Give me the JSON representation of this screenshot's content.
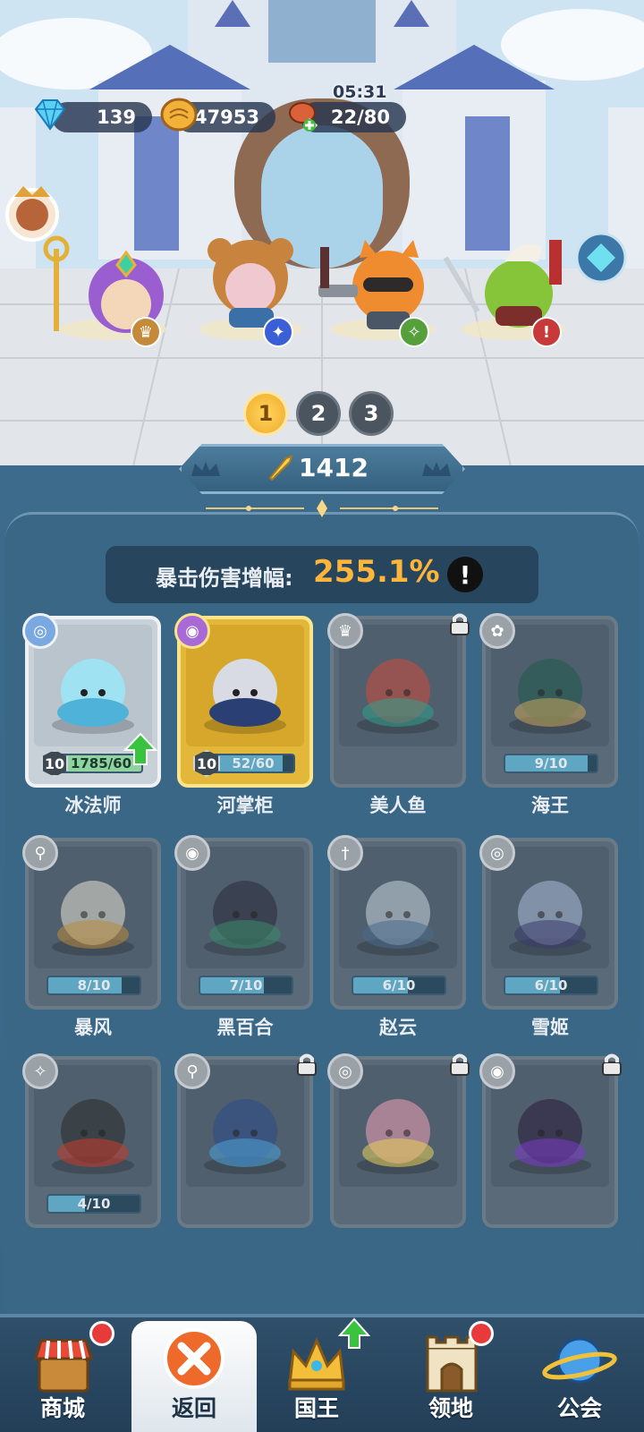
{
  "resources": {
    "gems": "139",
    "coins": "47953",
    "stamina_timer": "05:31",
    "stamina": "22/80"
  },
  "team_pages": [
    "1",
    "2",
    "3"
  ],
  "team_page_selected": "1",
  "power": "1412",
  "crit_bonus": {
    "label": "暴击伤害增幅:",
    "value": "255.1%",
    "info_glyph": "!"
  },
  "heroes": [
    {
      "name": "冰法师",
      "level": "10",
      "progress": "1785/60",
      "state": "owned",
      "class_icon": "swirl-icon",
      "upgrade": true
    },
    {
      "name": "河掌柜",
      "level": "10",
      "progress": "52/60",
      "fill": 0.87,
      "state": "gold",
      "class_icon": "eye-icon",
      "upgrade": false
    },
    {
      "name": "美人鱼",
      "level": "",
      "progress": "",
      "state": "locked",
      "class_icon": "crown-icon"
    },
    {
      "name": "海王",
      "level": "",
      "progress": "9/10",
      "fill": 0.9,
      "state": "shard",
      "class_icon": "paw-icon"
    },
    {
      "name": "暴风",
      "level": "",
      "progress": "8/10",
      "fill": 0.8,
      "state": "shard",
      "class_icon": "magnifier-icon"
    },
    {
      "name": "黑百合",
      "level": "",
      "progress": "7/10",
      "fill": 0.7,
      "state": "shard",
      "class_icon": "eye-icon"
    },
    {
      "name": "赵云",
      "level": "",
      "progress": "6/10",
      "fill": 0.6,
      "state": "shard",
      "class_icon": "sword-icon"
    },
    {
      "name": "雪姬",
      "level": "",
      "progress": "6/10",
      "fill": 0.6,
      "state": "shard",
      "class_icon": "swirl-icon"
    },
    {
      "name": "",
      "level": "",
      "progress": "4/10",
      "fill": 0.4,
      "state": "shard",
      "class_icon": "network-icon"
    },
    {
      "name": "",
      "level": "",
      "progress": "",
      "state": "locked",
      "class_icon": "magnifier-icon"
    },
    {
      "name": "",
      "level": "",
      "progress": "",
      "state": "locked",
      "class_icon": "swirl-icon"
    },
    {
      "name": "",
      "level": "",
      "progress": "",
      "state": "locked",
      "class_icon": "eye-icon"
    }
  ],
  "nav": [
    {
      "label": "商城",
      "icon": "shop-icon",
      "dot": true
    },
    {
      "label": "返回",
      "icon": "close-icon",
      "active": true
    },
    {
      "label": "国王",
      "icon": "crown-icon",
      "upgrade": true
    },
    {
      "label": "领地",
      "icon": "castle-icon",
      "dot": true
    },
    {
      "label": "公会",
      "icon": "planet-icon"
    }
  ],
  "colors": {
    "accent_gold": "#ffb43a",
    "panel": "#3b6786",
    "alert_red": "#e83a3a"
  }
}
